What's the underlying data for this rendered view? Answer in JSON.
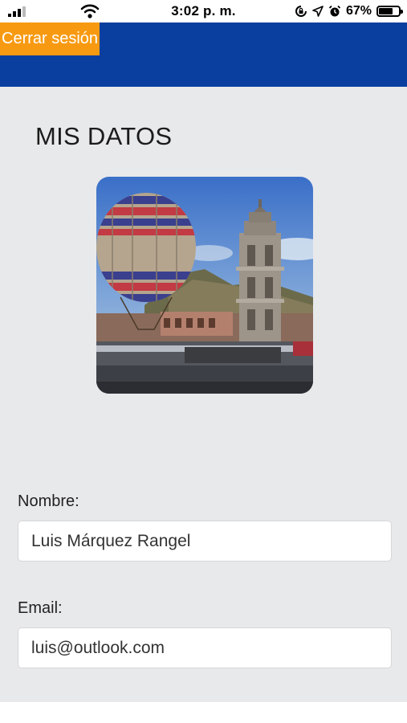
{
  "status_bar": {
    "time": "3:02 p. m.",
    "battery_percent": "67%",
    "battery_level": 0.67,
    "icons": [
      "signal-icon",
      "wifi-icon",
      "screen-lock-icon",
      "location-icon",
      "alarm-icon",
      "battery-icon"
    ]
  },
  "header": {
    "logout_label": "Cerrar sesión",
    "colors": {
      "bar": "#0a3f9f",
      "button": "#f79a12"
    }
  },
  "profile": {
    "title": "MIS DATOS",
    "photo_icon": "profile-photo",
    "fields": {
      "name": {
        "label": "Nombre:",
        "value": "Luis Márquez Rangel"
      },
      "email": {
        "label": "Email:",
        "value": "luis@outlook.com"
      }
    }
  },
  "colors": {
    "background": "#e8e9eb"
  }
}
